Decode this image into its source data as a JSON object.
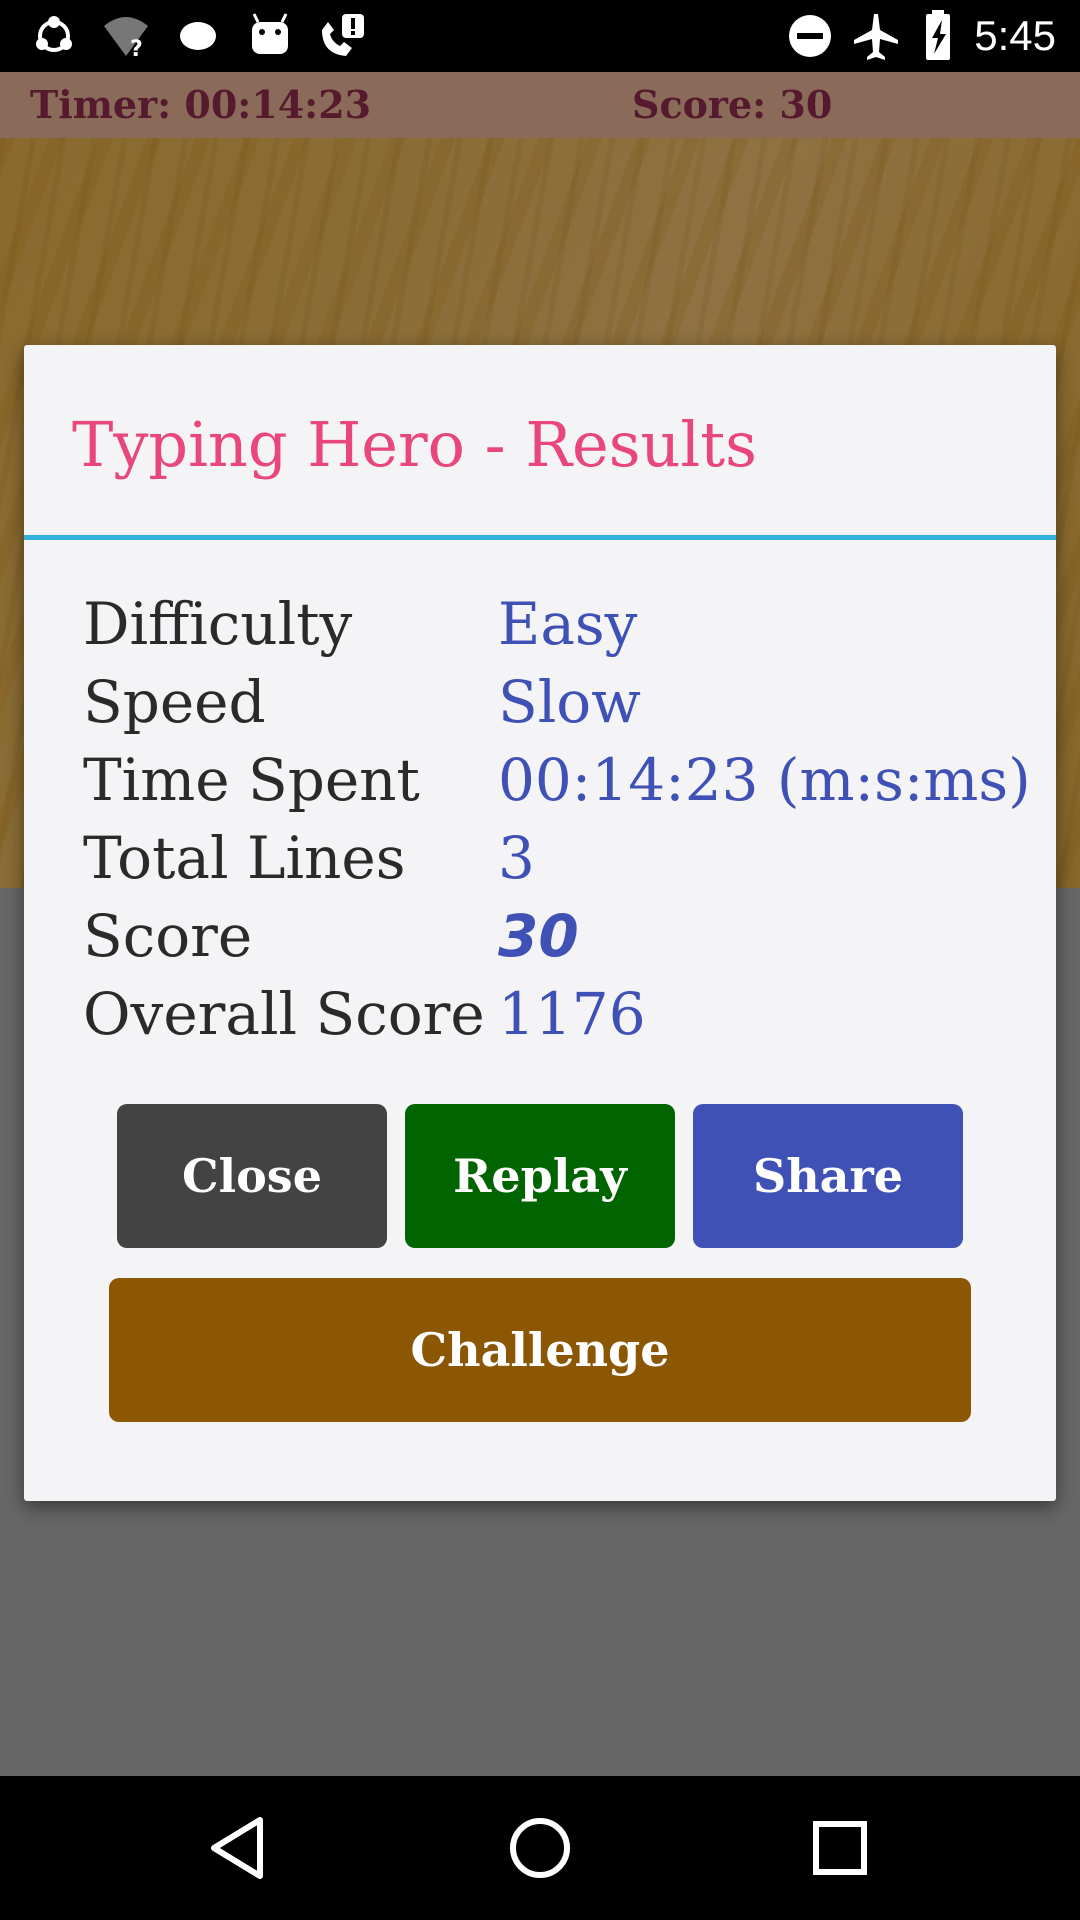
{
  "status_bar": {
    "time": "5:45",
    "left_icons": [
      "sync-icon",
      "wifi-question-icon",
      "message-bubble-icon",
      "android-icon",
      "phone-alert-icon"
    ],
    "right_icons": [
      "do-not-disturb-icon",
      "airplane-mode-icon",
      "battery-charging-icon"
    ]
  },
  "app_header": {
    "timer_text": "Timer: 00:14:23",
    "score_text": "Score: 30"
  },
  "dialog": {
    "title": "Typing Hero - Results",
    "rows": [
      {
        "label": "Difficulty",
        "value": "Easy"
      },
      {
        "label": "Speed",
        "value": "Slow"
      },
      {
        "label": "Time Spent",
        "value": "00:14:23 (m:s:ms)"
      },
      {
        "label": "Total Lines",
        "value": "3"
      },
      {
        "label": "Score",
        "value": "30"
      },
      {
        "label": "Overall Score",
        "value": "1176"
      }
    ],
    "buttons": {
      "close": "Close",
      "replay": "Replay",
      "share": "Share",
      "challenge": "Challenge"
    }
  },
  "nav_bar": {
    "icons": [
      "back-icon",
      "home-icon",
      "recents-icon"
    ]
  },
  "colors": {
    "title": "#e8467c",
    "divider": "#33b0dc",
    "value_text": "#3f51b5",
    "close_button": "#434343",
    "replay_button": "#006400",
    "share_button": "#3f51b5",
    "challenge_button": "#8b5704"
  }
}
